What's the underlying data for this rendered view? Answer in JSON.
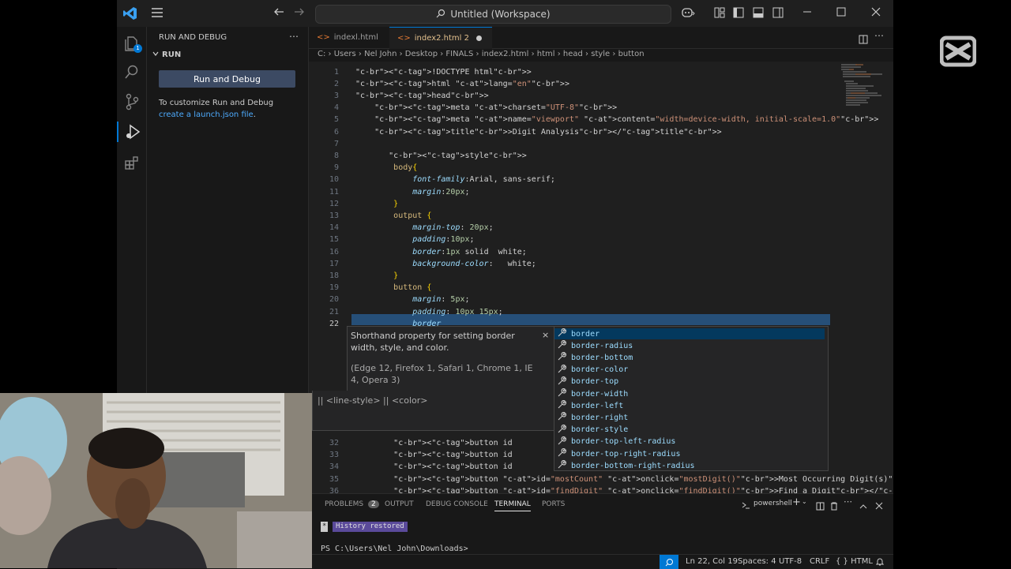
{
  "titlebar": {
    "title": "Untitled (Workspace)"
  },
  "activity": {
    "items": [
      "explorer-icon",
      "search-icon",
      "source-control-icon",
      "run-debug-icon",
      "extensions-icon"
    ]
  },
  "sidebar": {
    "title": "RUN AND DEBUG",
    "section": "RUN",
    "run_button": "Run and Debug",
    "hint_text": "To customize Run and Debug ",
    "hint_link": "create a launch.json file",
    "hint_end": "."
  },
  "tabs": [
    {
      "label": "indexl.html",
      "active": false
    },
    {
      "label": "index2.html 2",
      "active": true
    }
  ],
  "breadcrumb": [
    "C:",
    "Users",
    "Nel John",
    "Desktop",
    "FINALS",
    "index2.html",
    "html",
    "head",
    "style",
    "button"
  ],
  "editor": {
    "current_line": 22,
    "line_numbers": [
      1,
      2,
      3,
      4,
      5,
      6,
      7,
      8,
      9,
      10,
      11,
      12,
      13,
      14,
      15,
      16,
      17,
      18,
      19,
      20,
      21,
      22,
      32,
      33,
      34,
      35,
      36
    ],
    "lines": [
      "<!DOCTYPE html>",
      "<html lang=\"en\">",
      "<head>",
      "    <meta charset=\"UTF-8\">",
      "    <meta name=\"viewport\" content=\"width=device-width, initial-scale=1.0\">",
      "    <title>Digit Analysis</title>",
      "",
      "       <style>",
      "        body{",
      "            font-family:Arial, sans-serif;",
      "            margin:20px;",
      "        }",
      "        output {",
      "            margin-top: 20px;",
      "            padding:10px;",
      "            border:1px solid  white;",
      "            background-color:   white;",
      "        }",
      "        button {",
      "            margin: 5px;",
      "            padding: 10px 15px;",
      "            border",
      "        <button id",
      "        <button id",
      "        <button id",
      "        <button id=\"mostCount\" onclick=\"mostDigit()\">Most Occurring Digit(s)</button>",
      "        <button id=\"findDigit\" onclick=\"findDigit()\">Find a Digit</button>"
    ]
  },
  "hover": {
    "description": "Shorthand property for setting border width, style, and color.",
    "compat": "(Edge 12, Firefox 1, Safari 1, Chrome 1, IE 4, Opera 3)",
    "syntax": "|| <line-style> || <color>"
  },
  "suggestions": [
    "border",
    "border-radius",
    "border-bottom",
    "border-color",
    "border-top",
    "border-width",
    "border-left",
    "border-right",
    "border-style",
    "border-top-left-radius",
    "border-top-right-radius",
    "border-bottom-right-radius"
  ],
  "partial_tails": {
    "l32": "button>",
    "l33": "</button>",
    "l34": "button>"
  },
  "panel": {
    "tabs": [
      "PROBLEMS",
      "OUTPUT",
      "DEBUG CONSOLE",
      "TERMINAL",
      "PORTS"
    ],
    "problems_count": "2",
    "active_tab": "TERMINAL",
    "shell": "powershell",
    "history": "History restored",
    "prompt": "PS C:\\Users\\Nel John\\Downloads>"
  },
  "status": {
    "position": "Ln 22, Col 19",
    "spaces": "Spaces: 4",
    "encoding": "UTF-8",
    "eol": "CRLF",
    "language": "HTML"
  },
  "colors": {
    "accent": "#0078d4",
    "selection": "#04395e",
    "run_button": "#3c4a63"
  }
}
